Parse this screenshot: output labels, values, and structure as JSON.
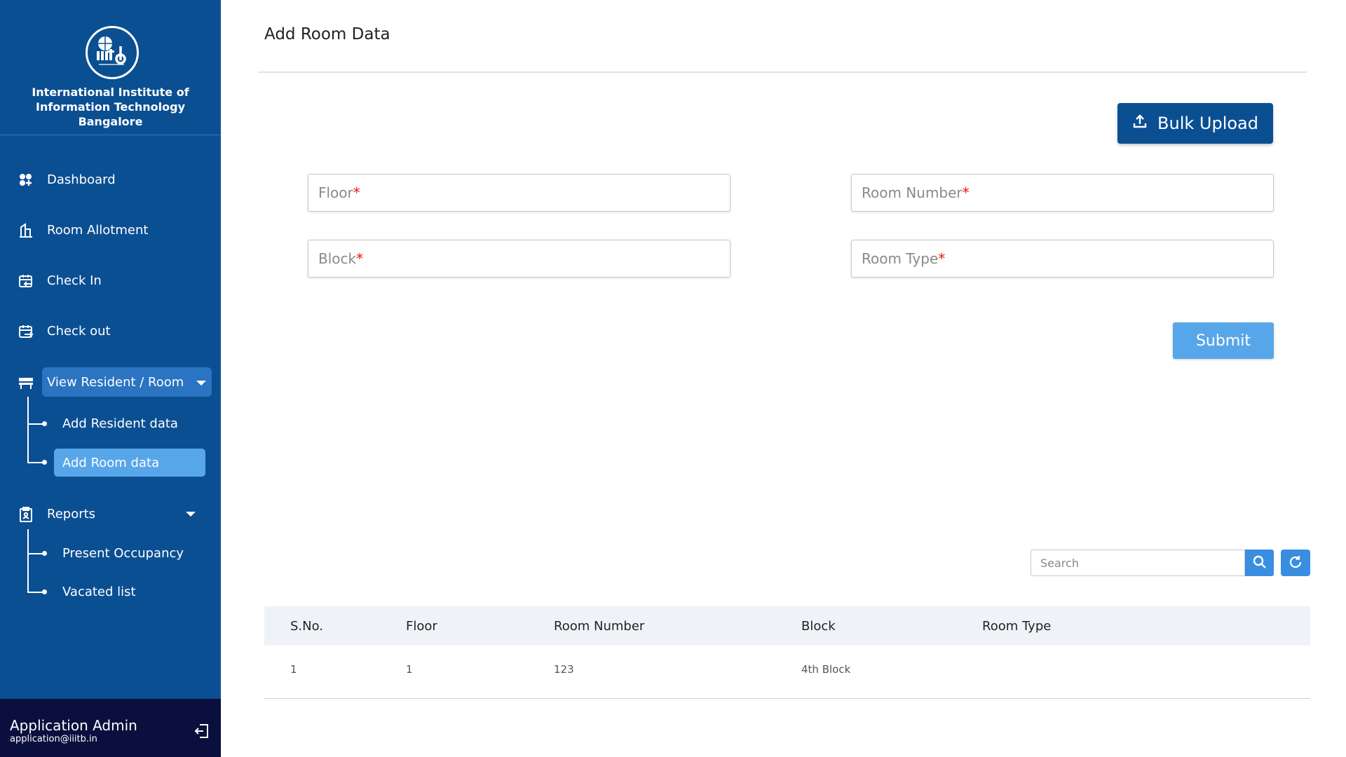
{
  "sidebar": {
    "institute_lines": [
      "International Institute of",
      "Information Technology",
      "Bangalore"
    ],
    "nav": {
      "dashboard": "Dashboard",
      "room_allotment": "Room Allotment",
      "check_in": "Check In",
      "check_out": "Check out",
      "view_resident_room": "View Resident / Room",
      "add_resident_data": "Add Resident data",
      "add_room_data": "Add Room data",
      "reports": "Reports",
      "present_occupancy": "Present Occupancy",
      "vacated_list": "Vacated list"
    },
    "user": {
      "name": "Application Admin",
      "email": "application@iiitb.in"
    }
  },
  "main": {
    "title": "Add Room Data",
    "bulk_upload_label": "Bulk Upload",
    "fields": {
      "floor": "Floor",
      "room_number": "Room Number",
      "block": "Block",
      "room_type": "Room Type",
      "required_mark": "*"
    },
    "submit_label": "Submit",
    "search_placeholder": "Search",
    "table": {
      "headers": [
        "S.No.",
        "Floor",
        "Room Number",
        "Block",
        "Room Type"
      ],
      "rows": [
        [
          "1",
          "1",
          "123",
          "4th Block",
          ""
        ]
      ]
    }
  },
  "colors": {
    "sidebar_bg": "#0b4f93",
    "active_pill": "#2b74c2",
    "selected_item": "#58a6ea",
    "user_box_bg": "#0a0f3d",
    "primary_button": "#0b4f93",
    "submit_button": "#58a6ea",
    "required_star": "#ee1111"
  }
}
